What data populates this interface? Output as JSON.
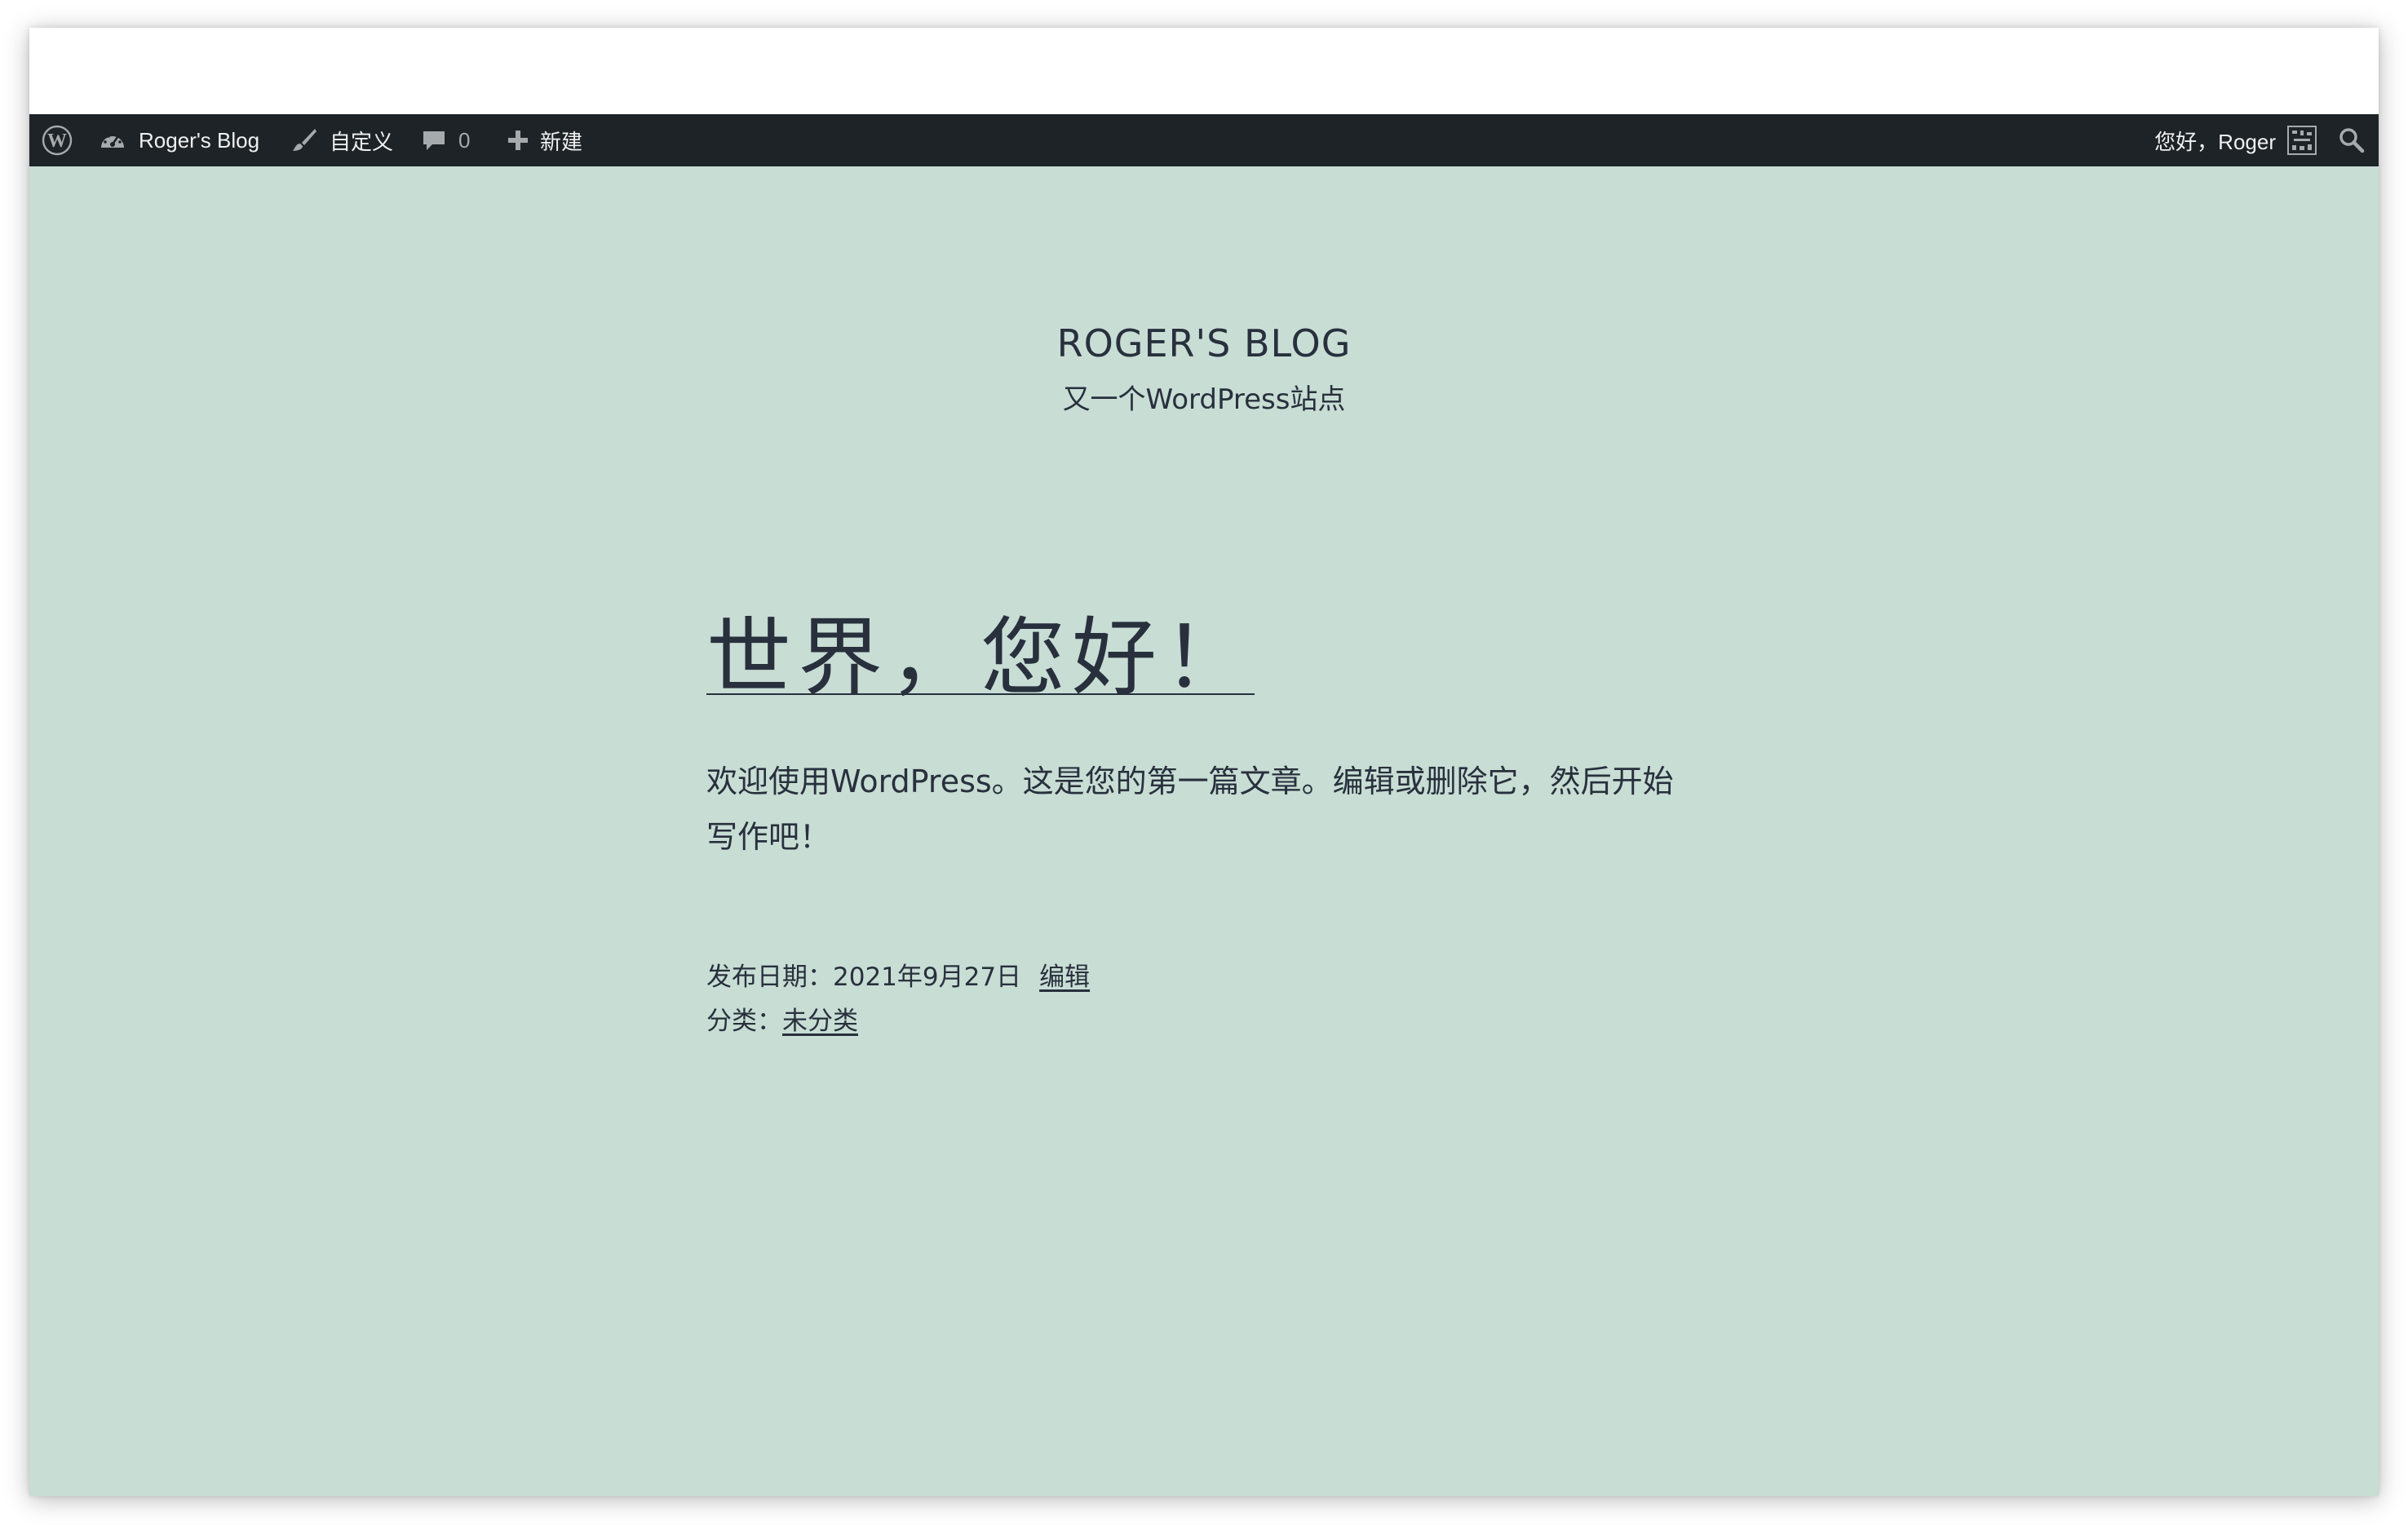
{
  "admin_bar": {
    "wp_logo_icon": "wordpress-logo-icon",
    "site_name": "Roger's Blog",
    "customize_label": "自定义",
    "comments_count": "0",
    "new_label": "新建",
    "greeting": "您好，Roger",
    "search_icon": "search-icon"
  },
  "site": {
    "title": "ROGER'S BLOG",
    "description": "又一个WordPress站点"
  },
  "post": {
    "title": "世界，您好！",
    "body": "欢迎使用WordPress。这是您的第一篇文章。编辑或删除它，然后开始写作吧！",
    "published_prefix": "发布日期：",
    "published_date": "2021年9月27日",
    "edit_link": "编辑",
    "category_prefix": "分类：",
    "category": "未分类"
  },
  "colors": {
    "admin_bar_bg": "#1d2327",
    "page_bg": "#c8ddd4",
    "text": "#28303d"
  }
}
